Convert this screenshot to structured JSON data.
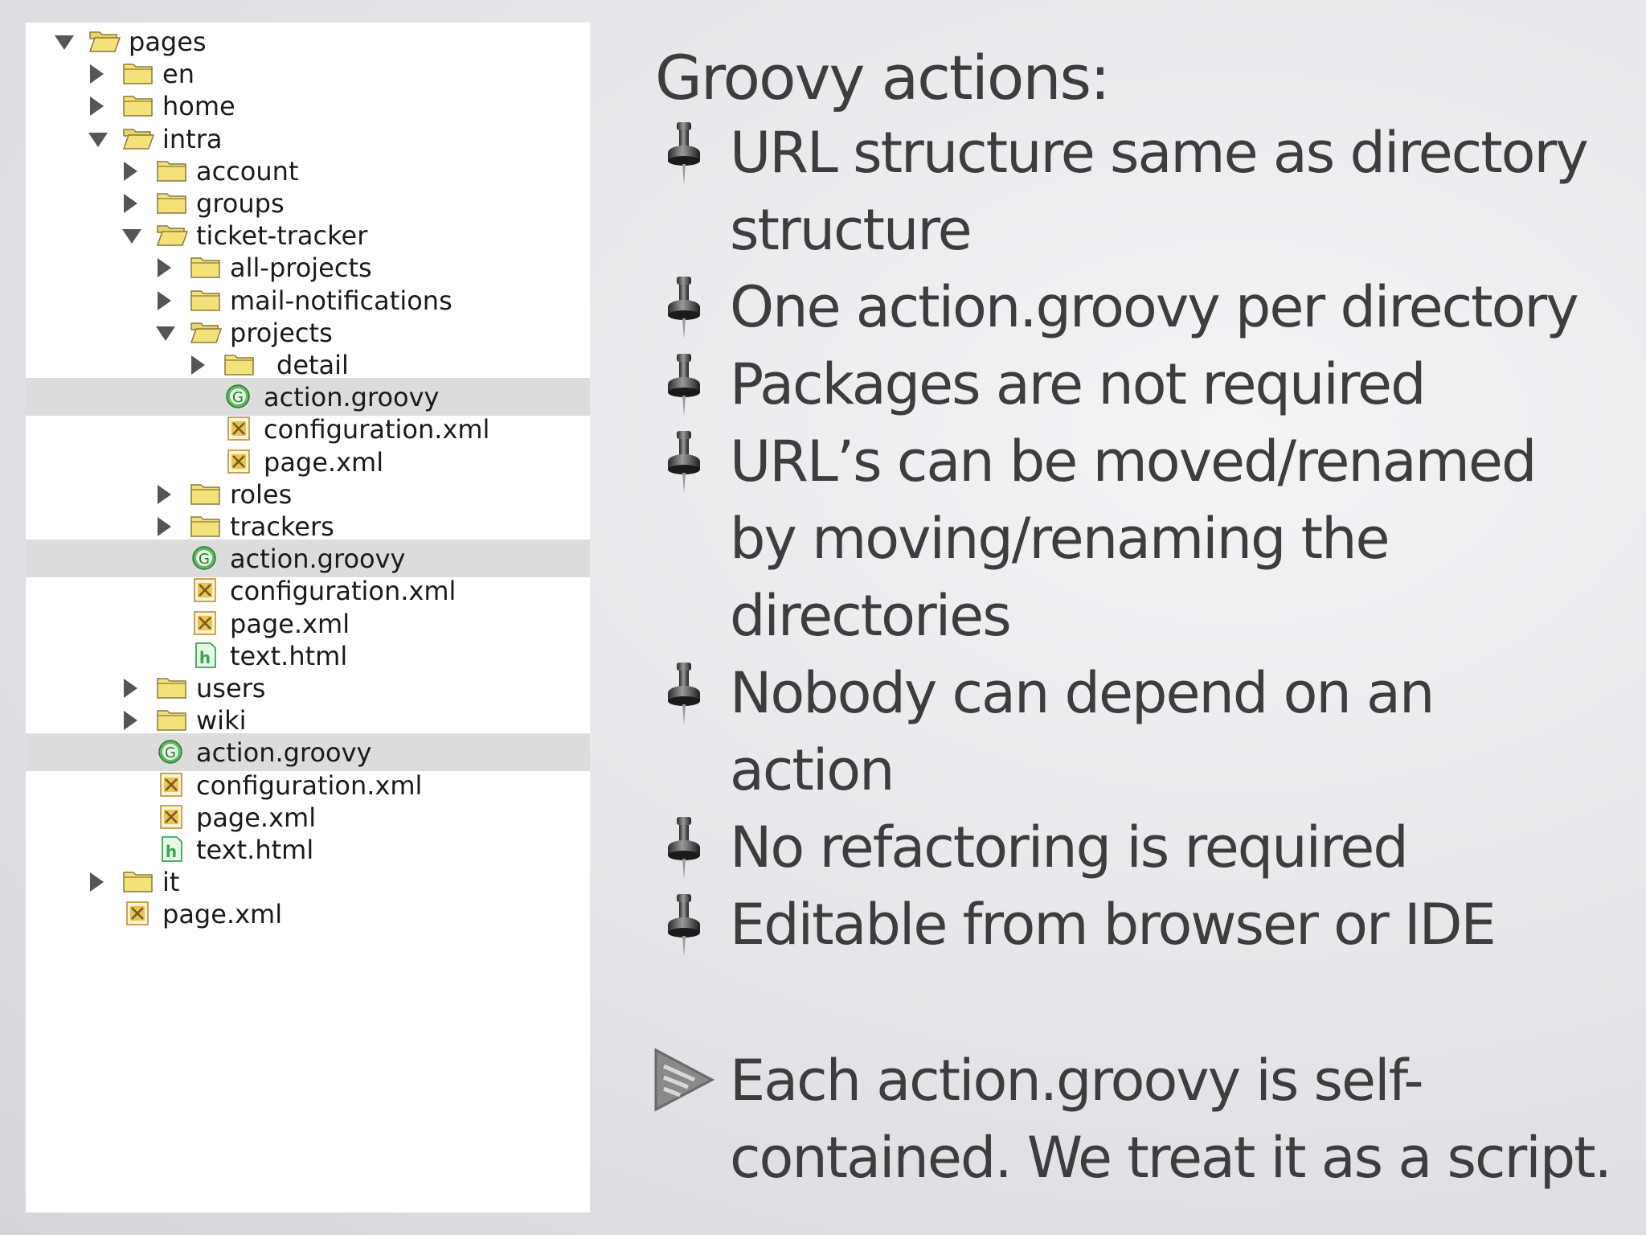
{
  "tree": [
    {
      "label": "pages",
      "type": "folder",
      "depth": 0,
      "state": "expanded"
    },
    {
      "label": "en",
      "type": "folder",
      "depth": 1,
      "state": "collapsed"
    },
    {
      "label": "home",
      "type": "folder",
      "depth": 1,
      "state": "collapsed"
    },
    {
      "label": "intra",
      "type": "folder",
      "depth": 1,
      "state": "expanded"
    },
    {
      "label": "account",
      "type": "folder",
      "depth": 2,
      "state": "collapsed"
    },
    {
      "label": "groups",
      "type": "folder",
      "depth": 2,
      "state": "collapsed"
    },
    {
      "label": "ticket-tracker",
      "type": "folder",
      "depth": 2,
      "state": "expanded"
    },
    {
      "label": "all-projects",
      "type": "folder",
      "depth": 3,
      "state": "collapsed"
    },
    {
      "label": "mail-notifications",
      "type": "folder",
      "depth": 3,
      "state": "collapsed"
    },
    {
      "label": "projects",
      "type": "folder",
      "depth": 3,
      "state": "expanded"
    },
    {
      "label": "_detail",
      "type": "folder",
      "depth": 4,
      "state": "collapsed"
    },
    {
      "label": "action.groovy",
      "type": "groovy",
      "depth": 4,
      "selected": true
    },
    {
      "label": "configuration.xml",
      "type": "xml",
      "depth": 4
    },
    {
      "label": "page.xml",
      "type": "xml",
      "depth": 4
    },
    {
      "label": "roles",
      "type": "folder",
      "depth": 3,
      "state": "collapsed"
    },
    {
      "label": "trackers",
      "type": "folder",
      "depth": 3,
      "state": "collapsed"
    },
    {
      "label": "action.groovy",
      "type": "groovy",
      "depth": 3,
      "selected": true
    },
    {
      "label": "configuration.xml",
      "type": "xml",
      "depth": 3
    },
    {
      "label": "page.xml",
      "type": "xml",
      "depth": 3
    },
    {
      "label": "text.html",
      "type": "html",
      "depth": 3
    },
    {
      "label": "users",
      "type": "folder",
      "depth": 2,
      "state": "collapsed"
    },
    {
      "label": "wiki",
      "type": "folder",
      "depth": 2,
      "state": "collapsed"
    },
    {
      "label": "action.groovy",
      "type": "groovy",
      "depth": 2,
      "selected": true
    },
    {
      "label": "configuration.xml",
      "type": "xml",
      "depth": 2
    },
    {
      "label": "page.xml",
      "type": "xml",
      "depth": 2
    },
    {
      "label": "text.html",
      "type": "html",
      "depth": 2
    },
    {
      "label": "it",
      "type": "folder",
      "depth": 1,
      "state": "collapsed"
    },
    {
      "label": "page.xml",
      "type": "xml",
      "depth": 1
    }
  ],
  "slide": {
    "title": "Groovy actions:",
    "bullets": [
      {
        "lines": [
          "URL structure same as directory",
          "structure"
        ]
      },
      {
        "lines": [
          "One action.groovy per directory"
        ]
      },
      {
        "lines": [
          "Packages are not required"
        ]
      },
      {
        "lines": [
          "URL’s can be moved/renamed",
          "by moving/renaming the",
          "directories"
        ]
      },
      {
        "lines": [
          "Nobody can depend on an",
          "action"
        ]
      },
      {
        "lines": [
          "No refactoring is required"
        ]
      },
      {
        "lines": [
          "Editable from browser or IDE"
        ]
      }
    ],
    "note_lines": [
      "Each action.groovy is self-",
      "contained. We treat it as a script."
    ],
    "colors": {
      "text": "#3d3d3d",
      "folder": "#f3e27a",
      "groovy": "#5cb85c",
      "xml": "#e8c25a",
      "html": "#38a84a"
    },
    "icons": {
      "bullet": "pushpin-icon",
      "note": "triangle-arrow-icon"
    }
  }
}
